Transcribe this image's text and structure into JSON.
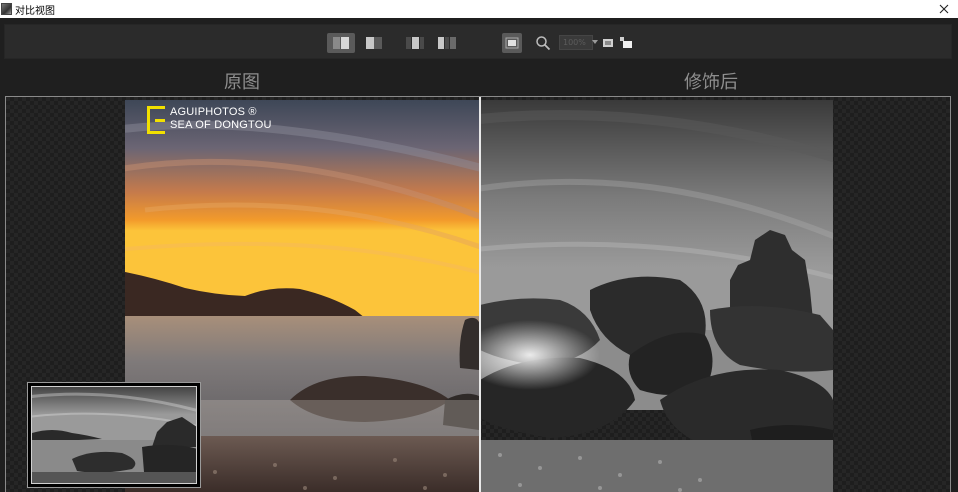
{
  "window": {
    "title": "对比视图",
    "close_glyph": "✕"
  },
  "toolbar": {
    "buttons": [
      {
        "name": "side-by-side-view-button",
        "icon": "split-view-icon",
        "active": true
      },
      {
        "name": "single-view-button",
        "icon": "half-view-icon",
        "active": false
      },
      {
        "name": "left-compare-button",
        "icon": "compare-left-icon",
        "active": false
      },
      {
        "name": "right-compare-button",
        "icon": "compare-right-icon",
        "active": false
      },
      {
        "name": "fit-screen-button",
        "icon": "fit-screen-icon",
        "active": true
      },
      {
        "name": "zoom-button",
        "icon": "magnifier-icon",
        "active": false
      },
      {
        "name": "fill-button",
        "icon": "fill-icon",
        "active": false
      },
      {
        "name": "hand-tool-button",
        "icon": "pan-icon",
        "active": false
      }
    ],
    "zoom_value": "100%"
  },
  "labels": {
    "original": "原图",
    "edited": "修饰后"
  },
  "watermark": {
    "line1": "AGUIPHOTOS ®",
    "line2": "SEA OF DONGTOU"
  },
  "colors": {
    "accent_yellow": "#f2e000",
    "toolbar_bg": "#2b2b2b",
    "window_bg": "#1f1f1f"
  }
}
